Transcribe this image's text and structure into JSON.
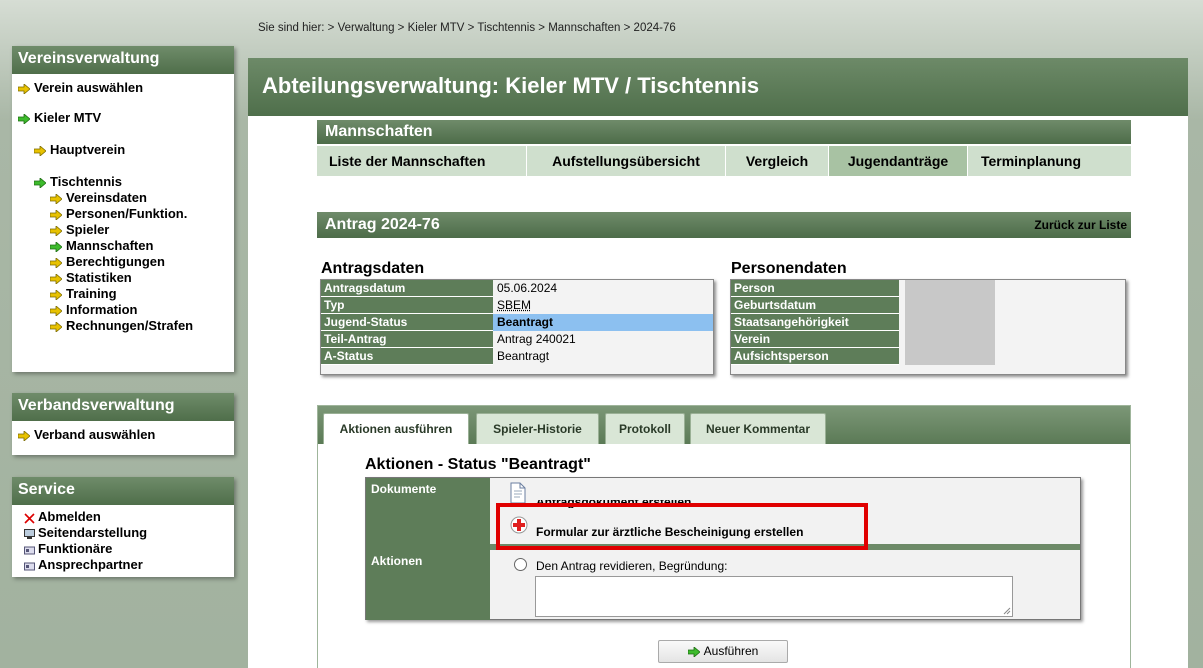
{
  "breadcrumb": "Sie sind hier: > Verwaltung > Kieler MTV > Tischtennis > Mannschaften > 2024-76",
  "sidebar": {
    "vereinsverwaltung": {
      "title": "Vereinsverwaltung",
      "select": "Verein auswählen",
      "club": "Kieler MTV",
      "hauptverein": "Hauptverein",
      "department": "Tischtennis",
      "items": [
        "Vereinsdaten",
        "Personen/Funktion.",
        "Spieler",
        "Mannschaften",
        "Berechtigungen",
        "Statistiken",
        "Training",
        "Information",
        "Rechnungen/Strafen"
      ]
    },
    "verbandsverwaltung": {
      "title": "Verbandsverwaltung",
      "select": "Verband auswählen"
    },
    "service": {
      "title": "Service",
      "items": [
        "Abmelden",
        "Seitendarstellung",
        "Funktionäre",
        "Ansprechpartner"
      ]
    }
  },
  "header": {
    "title": "Abteilungsverwaltung: Kieler MTV / Tischtennis"
  },
  "mannschaften": {
    "title": "Mannschaften",
    "tabs": [
      "Liste der Mannschaften",
      "Aufstellungsübersicht",
      "Vergleich",
      "Jugendanträge",
      "Terminplanung"
    ],
    "active_tab": "Jugendanträge"
  },
  "antrag": {
    "title": "Antrag 2024-76",
    "back_link": "Zurück zur Liste"
  },
  "antragsdaten": {
    "title": "Antragsdaten",
    "rows": [
      {
        "label": "Antragsdatum",
        "value": "05.06.2024"
      },
      {
        "label": "Typ",
        "value": "SBEM"
      },
      {
        "label": "Jugend-Status",
        "value": "Beantragt"
      },
      {
        "label": "Teil-Antrag",
        "value": "Antrag 240021"
      },
      {
        "label": "A-Status",
        "value": "Beantragt"
      }
    ]
  },
  "personendaten": {
    "title": "Personendaten",
    "rows": [
      "Person",
      "Geburtsdatum",
      "Staatsangehörigkeit",
      "Verein",
      "Aufsichtsperson"
    ]
  },
  "panel_tabs": [
    "Aktionen ausführen",
    "Spieler-Historie",
    "Protokoll",
    "Neuer Kommentar"
  ],
  "aktionen": {
    "title": "Aktionen - Status \"Beantragt\"",
    "dokumente_label": "Dokumente",
    "doc1": "Antragsdokument erstellen",
    "doc2": "Formular zur ärztliche Bescheinigung erstellen",
    "aktionen_label": "Aktionen",
    "revise": "Den Antrag revidieren, Begründung:",
    "reason_value": "",
    "submit": "Ausführen"
  },
  "colors": {
    "accent_green": "#5e7d59",
    "highlight_blue": "#8cc0f0",
    "callout_red": "#e00000"
  }
}
